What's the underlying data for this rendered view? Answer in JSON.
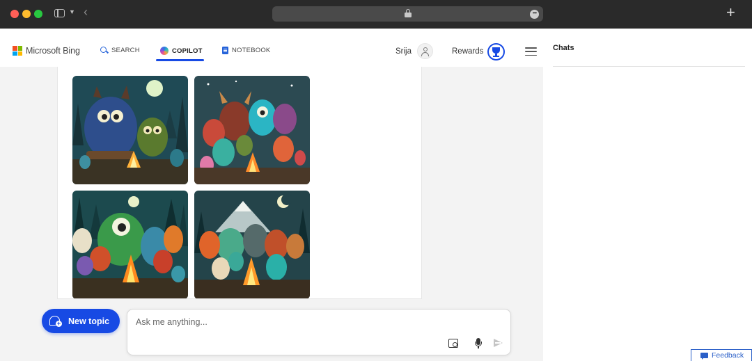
{
  "browser": {
    "new_tab_label": "+"
  },
  "header": {
    "logo_text": "Microsoft Bing",
    "logo_colors": [
      "#f25022",
      "#7fba00",
      "#00a4ef",
      "#ffb900"
    ],
    "nav": [
      {
        "label": "SEARCH",
        "icon": "search-icon",
        "active": false
      },
      {
        "label": "COPILOT",
        "icon": "copilot-icon",
        "active": true
      },
      {
        "label": "NOTEBOOK",
        "icon": "notebook-icon",
        "active": false
      }
    ],
    "user_name": "Srija",
    "rewards_label": "Rewards",
    "accent_color": "#174ae4"
  },
  "main": {
    "images": [
      {
        "name": "generated-image-1",
        "icon": "image"
      },
      {
        "name": "generated-image-2",
        "icon": "image"
      },
      {
        "name": "generated-image-3",
        "icon": "image"
      },
      {
        "name": "generated-image-4",
        "icon": "image"
      }
    ],
    "new_topic_label": "New topic",
    "input": {
      "placeholder": "Ask me anything...",
      "value": ""
    }
  },
  "sidebar": {
    "title": "Chats"
  },
  "feedback_label": "Feedback"
}
